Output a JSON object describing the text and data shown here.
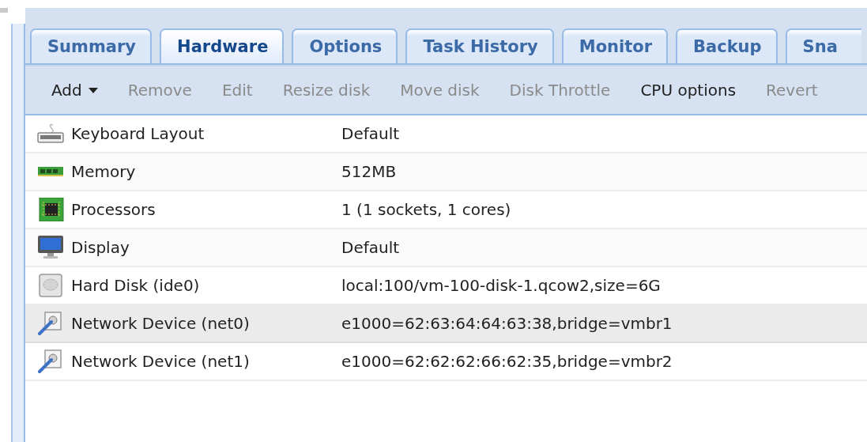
{
  "tabs": [
    {
      "label": "Summary",
      "selected": false
    },
    {
      "label": "Hardware",
      "selected": true
    },
    {
      "label": "Options",
      "selected": false
    },
    {
      "label": "Task History",
      "selected": false
    },
    {
      "label": "Monitor",
      "selected": false
    },
    {
      "label": "Backup",
      "selected": false
    },
    {
      "label": "Sna",
      "selected": false
    }
  ],
  "toolbar": [
    {
      "label": "Add",
      "kind": "menu",
      "disabled": false
    },
    {
      "label": "Remove",
      "kind": "button",
      "disabled": true
    },
    {
      "label": "Edit",
      "kind": "button",
      "disabled": true
    },
    {
      "label": "Resize disk",
      "kind": "button",
      "disabled": true
    },
    {
      "label": "Move disk",
      "kind": "button",
      "disabled": true
    },
    {
      "label": "Disk Throttle",
      "kind": "button",
      "disabled": true
    },
    {
      "label": "CPU options",
      "kind": "button",
      "disabled": false
    },
    {
      "label": "Revert",
      "kind": "button",
      "disabled": true
    }
  ],
  "hardware": [
    {
      "kind": "keyboard",
      "name": "Keyboard Layout",
      "value": "Default",
      "selected": false
    },
    {
      "kind": "memory",
      "name": "Memory",
      "value": "512MB",
      "selected": false
    },
    {
      "kind": "cpu",
      "name": "Processors",
      "value": "1 (1 sockets, 1 cores)",
      "selected": false
    },
    {
      "kind": "display",
      "name": "Display",
      "value": "Default",
      "selected": false
    },
    {
      "kind": "disk",
      "name": "Hard Disk (ide0)",
      "value": "local:100/vm-100-disk-1.qcow2,size=6G",
      "selected": false
    },
    {
      "kind": "network",
      "name": "Network Device (net0)",
      "value": "e1000=62:63:64:64:63:38,bridge=vmbr1",
      "selected": true
    },
    {
      "kind": "network",
      "name": "Network Device (net1)",
      "value": "e1000=62:62:62:66:62:35,bridge=vmbr2",
      "selected": false
    }
  ]
}
